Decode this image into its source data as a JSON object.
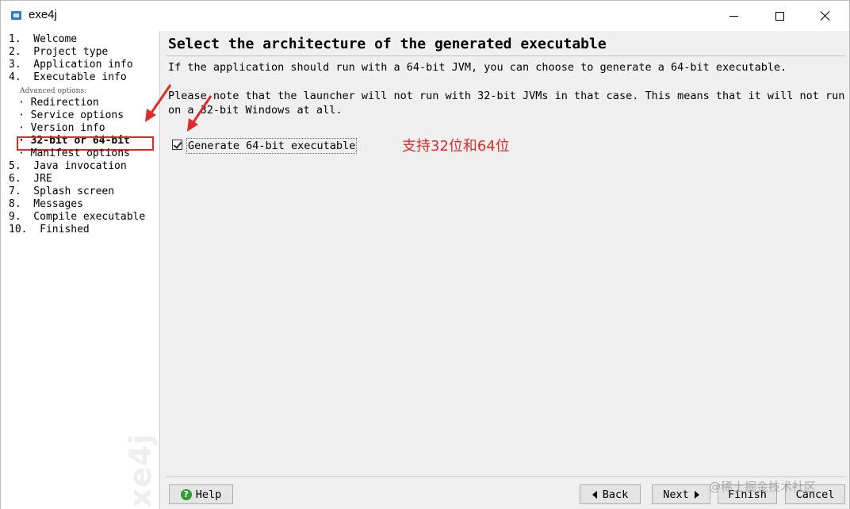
{
  "window": {
    "title": "exe4j",
    "watermark": "exe4j"
  },
  "sidebar": {
    "steps": [
      {
        "label": "1.  Welcome"
      },
      {
        "label": "2.  Project type"
      },
      {
        "label": "3.  Application info"
      },
      {
        "label": "4.  Executable info"
      }
    ],
    "advanced_label": "Advanced options:",
    "sub_items": [
      {
        "label": "· Redirection"
      },
      {
        "label": "· Service options"
      },
      {
        "label": "· Version info"
      },
      {
        "label": "· 32-bit or 64-bit"
      },
      {
        "label": "· Manifest options"
      }
    ],
    "steps_after": [
      {
        "label": "5.  Java invocation"
      },
      {
        "label": "6.  JRE"
      },
      {
        "label": "7.  Splash screen"
      },
      {
        "label": "8.  Messages"
      },
      {
        "label": "9.  Compile executable"
      },
      {
        "label": "10.  Finished"
      }
    ]
  },
  "main": {
    "title": "Select the architecture of the generated executable",
    "para1": "If the application should run with a 64-bit JVM, you can choose to generate a 64-bit executable.",
    "para2_line1": "Please note that the launcher will not run with 32-bit JVMs in that case. This means that it will not run",
    "para2_line2": "on a 32-bit Windows at all.",
    "checkbox_label": "Generate 64-bit executable",
    "checkbox_checked": true,
    "annotation": "支持32位和64位"
  },
  "buttons": {
    "help": "Help",
    "back": "Back",
    "next": "Next",
    "finish": "Finish",
    "cancel": "Cancel"
  },
  "site_watermark": "@稀土掘金技术社区",
  "colors": {
    "annotation": "#e02a2a",
    "help_icon": "#2f9e33"
  }
}
